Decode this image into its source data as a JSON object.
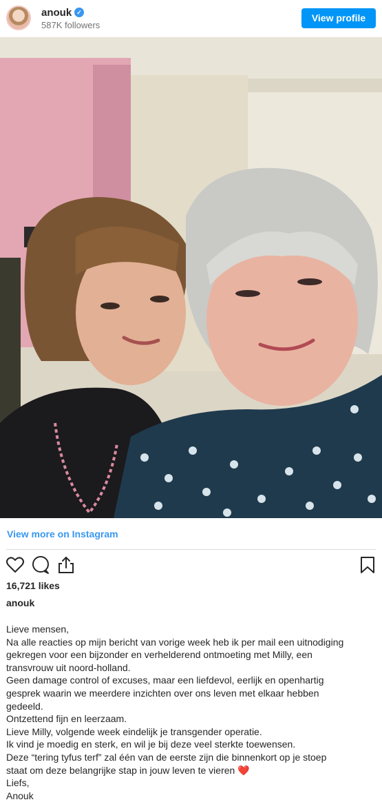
{
  "header": {
    "username": "anouk",
    "verified_icon": "verified-badge-icon",
    "followers": "587K followers",
    "view_profile_label": "View profile"
  },
  "post": {
    "view_more_label": "View more on Instagram",
    "likes": "16,721 likes",
    "caption_user": "anouk",
    "caption_lines": [
      "Lieve mensen,",
      "Na alle reacties op mijn bericht van vorige week heb ik per mail een uitnodiging",
      "gekregen voor een bijzonder en verhelderend ontmoeting met Milly, een",
      "transvrouw uit noord-holland.",
      "Geen damage control of excuses, maar een liefdevol, eerlijk en openhartig",
      "gesprek waarin we meerdere inzichten over ons leven met elkaar hebben",
      "gedeeld.",
      "Ontzettend fijn en leerzaam.",
      "Lieve Milly, volgende week eindelijk je transgender operatie.",
      "Ik vind je moedig en sterk, en wil je bij deze veel sterkte toewensen.",
      "Deze “tering tyfus terf” zal één van de eerste zijn die binnenkort op je stoep",
      "staat om deze belangrijke stap in jouw leven te vieren",
      "Liefs,",
      "Anouk"
    ],
    "caption_emoji": "❤️"
  },
  "colors": {
    "accent": "#0095f6",
    "link": "#3897f0",
    "text": "#262626",
    "muted": "#737373"
  }
}
